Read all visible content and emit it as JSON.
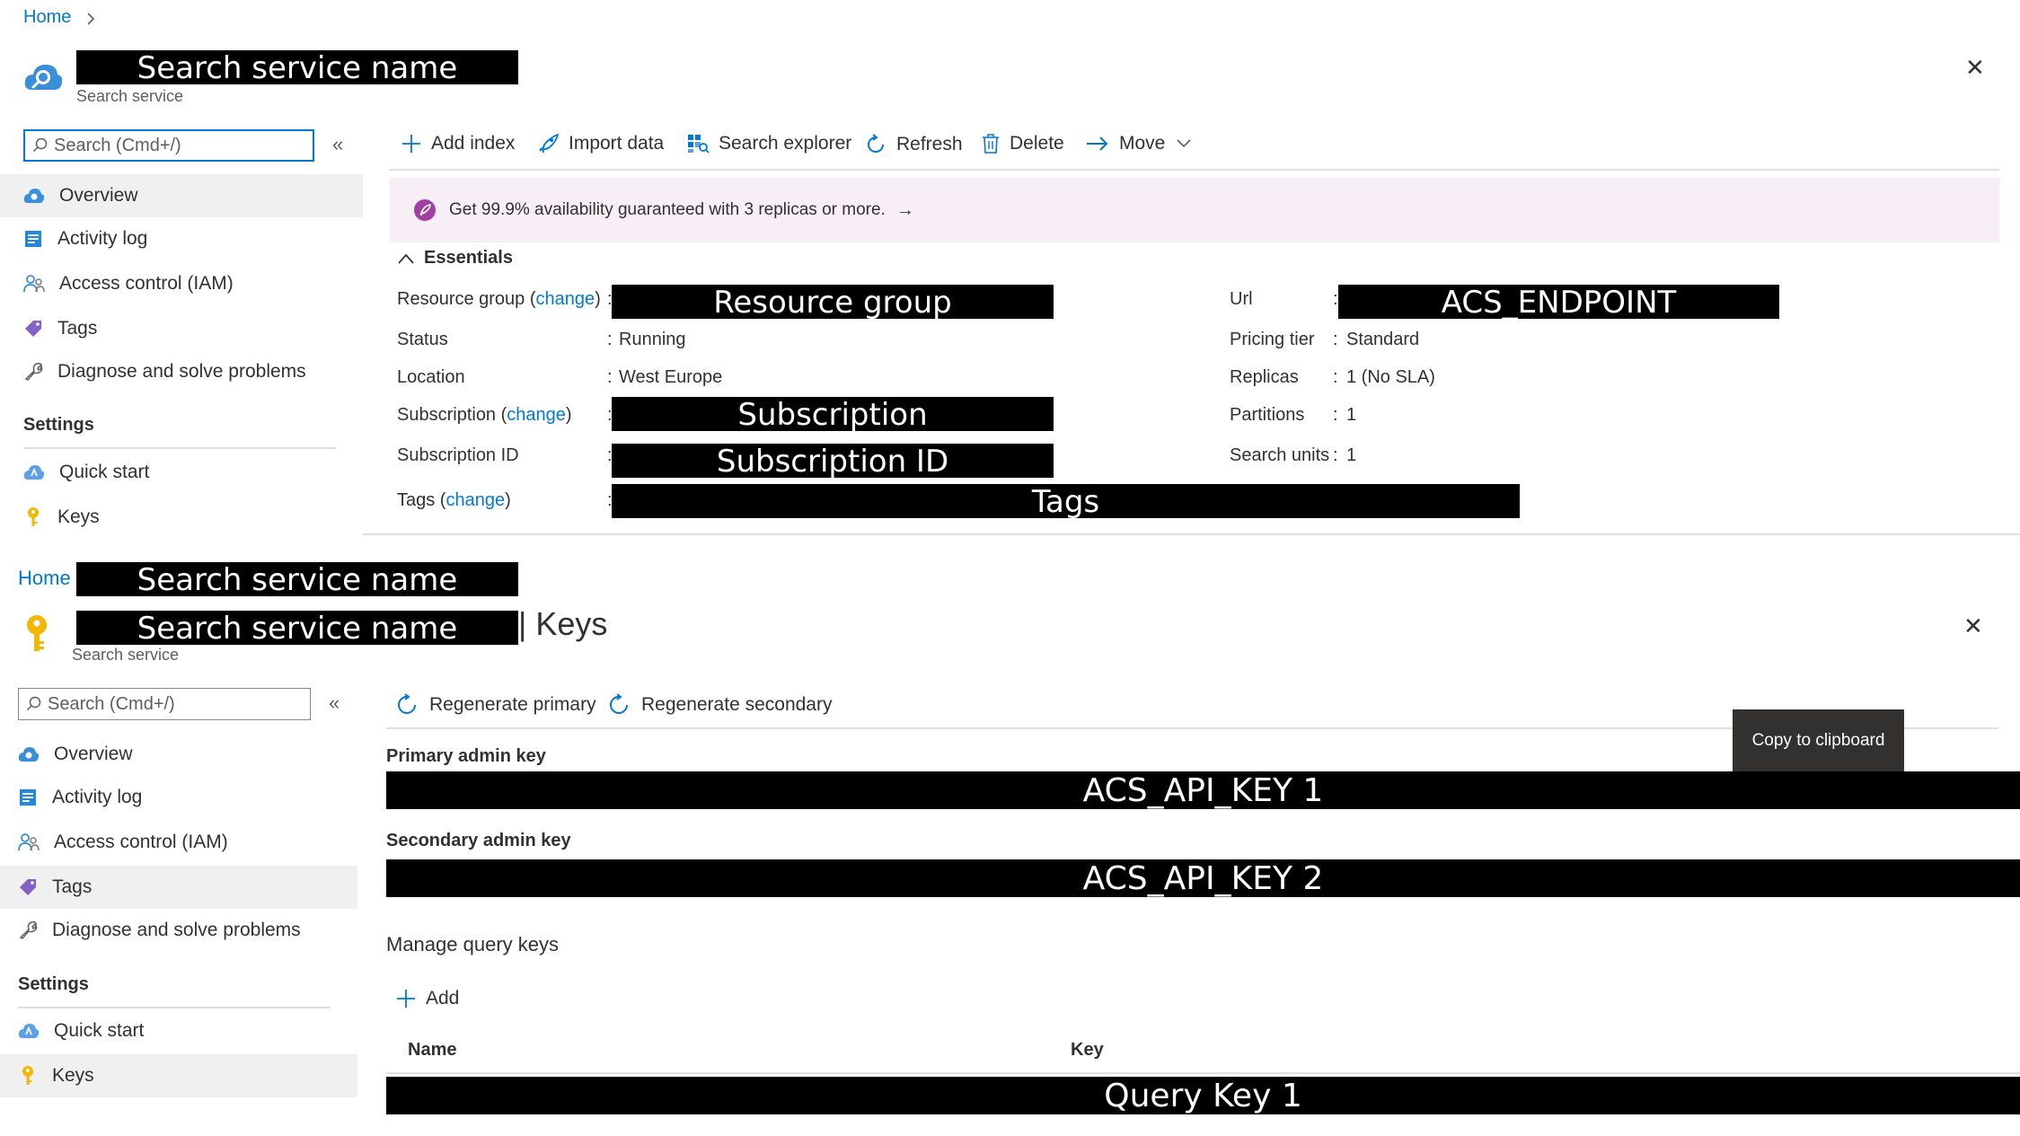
{
  "top": {
    "breadcrumb_home": "Home",
    "title_redacted": "Search service name",
    "subtitle": "Search service",
    "search_placeholder": "Search (Cmd+/)",
    "collapse_glyph": "«",
    "close_glyph": "✕",
    "nav": [
      {
        "label": "Overview",
        "icon": "cloud-search-icon"
      },
      {
        "label": "Activity log",
        "icon": "activity-log-icon"
      },
      {
        "label": "Access control (IAM)",
        "icon": "people-icon"
      },
      {
        "label": "Tags",
        "icon": "tag-icon"
      },
      {
        "label": "Diagnose and solve problems",
        "icon": "wrench-icon"
      }
    ],
    "settings_label": "Settings",
    "settings_nav": [
      {
        "label": "Quick start",
        "icon": "quickstart-icon"
      },
      {
        "label": "Keys",
        "icon": "key-icon"
      }
    ],
    "toolbar": {
      "add_index": "Add index",
      "import_data": "Import data",
      "search_explorer": "Search explorer",
      "refresh": "Refresh",
      "delete": "Delete",
      "move": "Move"
    },
    "banner": "Get 99.9% availability guaranteed with 3 replicas or more.",
    "banner_arrow": "→",
    "essentials_label": "Essentials",
    "essentials": {
      "resource_group_label": "Resource group",
      "change_text": "change",
      "resource_group_redacted": "Resource group",
      "status_label": "Status",
      "status_value": "Running",
      "location_label": "Location",
      "location_value": "West Europe",
      "subscription_label": "Subscription",
      "subscription_redacted": "Subscription",
      "subscription_id_label": "Subscription ID",
      "subscription_id_redacted": "Subscription ID",
      "tags_label": "Tags",
      "tags_redacted": "Tags",
      "url_label": "Url",
      "url_redacted": "ACS_ENDPOINT",
      "pricing_label": "Pricing tier",
      "pricing_value": "Standard",
      "replicas_label": "Replicas",
      "replicas_value": "1 (No SLA)",
      "partitions_label": "Partitions",
      "partitions_value": "1",
      "search_units_label": "Search units",
      "search_units_value": "1"
    }
  },
  "bottom": {
    "breadcrumb_home": "Home",
    "breadcrumb_redacted": "Search service name",
    "title_redacted": "Search service name",
    "title_suffix": "| Keys",
    "subtitle": "Search service",
    "search_placeholder": "Search (Cmd+/)",
    "collapse_glyph": "«",
    "close_glyph": "✕",
    "nav": [
      {
        "label": "Overview",
        "icon": "cloud-search-icon"
      },
      {
        "label": "Activity log",
        "icon": "activity-log-icon"
      },
      {
        "label": "Access control (IAM)",
        "icon": "people-icon"
      },
      {
        "label": "Tags",
        "icon": "tag-icon"
      },
      {
        "label": "Diagnose and solve problems",
        "icon": "wrench-icon"
      }
    ],
    "settings_label": "Settings",
    "settings_nav": [
      {
        "label": "Quick start",
        "icon": "quickstart-icon"
      },
      {
        "label": "Keys",
        "icon": "key-icon"
      }
    ],
    "toolbar": {
      "regenerate_primary": "Regenerate primary",
      "regenerate_secondary": "Regenerate secondary"
    },
    "tooltip": "Copy to clipboard",
    "primary_label": "Primary admin key",
    "primary_redacted": "ACS_API_KEY 1",
    "secondary_label": "Secondary admin key",
    "secondary_redacted": "ACS_API_KEY 2",
    "manage_label": "Manage query keys",
    "add_label": "Add",
    "col_name": "Name",
    "col_key": "Key",
    "query_key_redacted": "Query Key 1"
  },
  "colors": {
    "accent": "#0078d4",
    "banner_bg": "#f8eef6",
    "selected_bg": "#f0f0f0",
    "redaction": "#000000"
  }
}
